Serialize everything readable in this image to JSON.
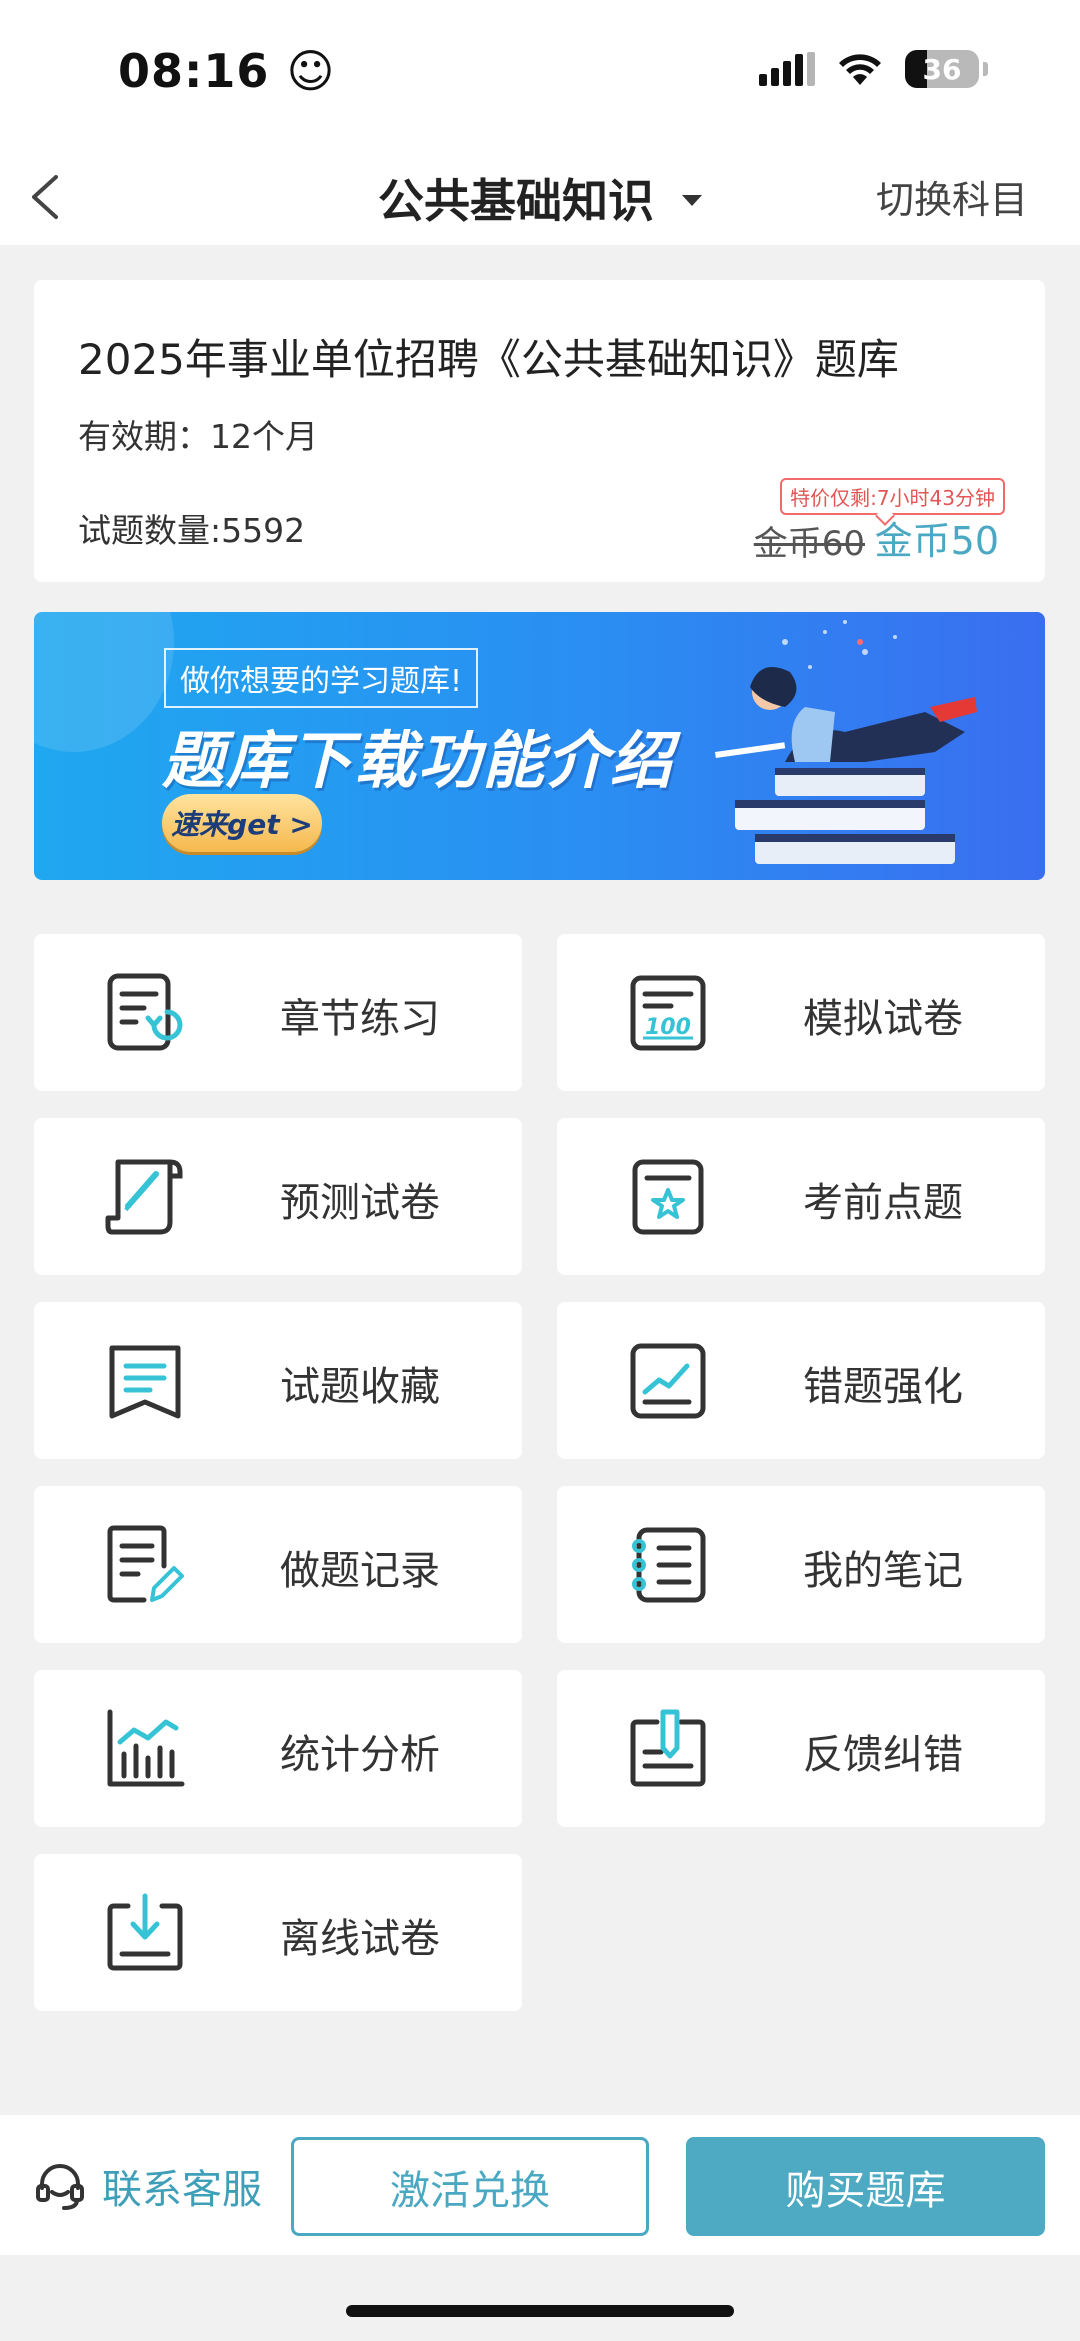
{
  "status_bar": {
    "time": "08:16 ☺",
    "battery": "36"
  },
  "nav": {
    "title": "公共基础知识",
    "switch_label": "切换科目"
  },
  "info_card": {
    "title": "2025年事业单位招聘《公共基础知识》题库",
    "validity": "有效期：12个月",
    "question_count": "试题数量:5592",
    "promo_tag": "特价仅剩:7小时43分钟",
    "price_original": "金币60",
    "price_current": "金币50"
  },
  "banner": {
    "subtitle": "做你想要的学习题库!",
    "headline": "题库下载功能介绍",
    "cta": "速来get >"
  },
  "menu": {
    "items": [
      {
        "label": "章节练习",
        "icon": "chapter-practice-icon"
      },
      {
        "label": "模拟试卷",
        "icon": "mock-exam-icon"
      },
      {
        "label": "预测试卷",
        "icon": "forecast-exam-icon"
      },
      {
        "label": "考前点题",
        "icon": "pre-exam-tips-icon"
      },
      {
        "label": "试题收藏",
        "icon": "favorites-icon"
      },
      {
        "label": "错题强化",
        "icon": "wrong-questions-icon"
      },
      {
        "label": "做题记录",
        "icon": "practice-record-icon"
      },
      {
        "label": "我的笔记",
        "icon": "notebook-icon"
      },
      {
        "label": "统计分析",
        "icon": "statistics-icon"
      },
      {
        "label": "反馈纠错",
        "icon": "feedback-icon"
      },
      {
        "label": "离线试卷",
        "icon": "offline-download-icon"
      }
    ]
  },
  "bottom_bar": {
    "support_label": "联系客服",
    "activate_label": "激活兑换",
    "buy_label": "购买题库"
  },
  "colors": {
    "accent": "#4aa8c2",
    "icon_accent": "#36c3d6",
    "promo": "#e25656",
    "banner": "#2a8ef2"
  }
}
